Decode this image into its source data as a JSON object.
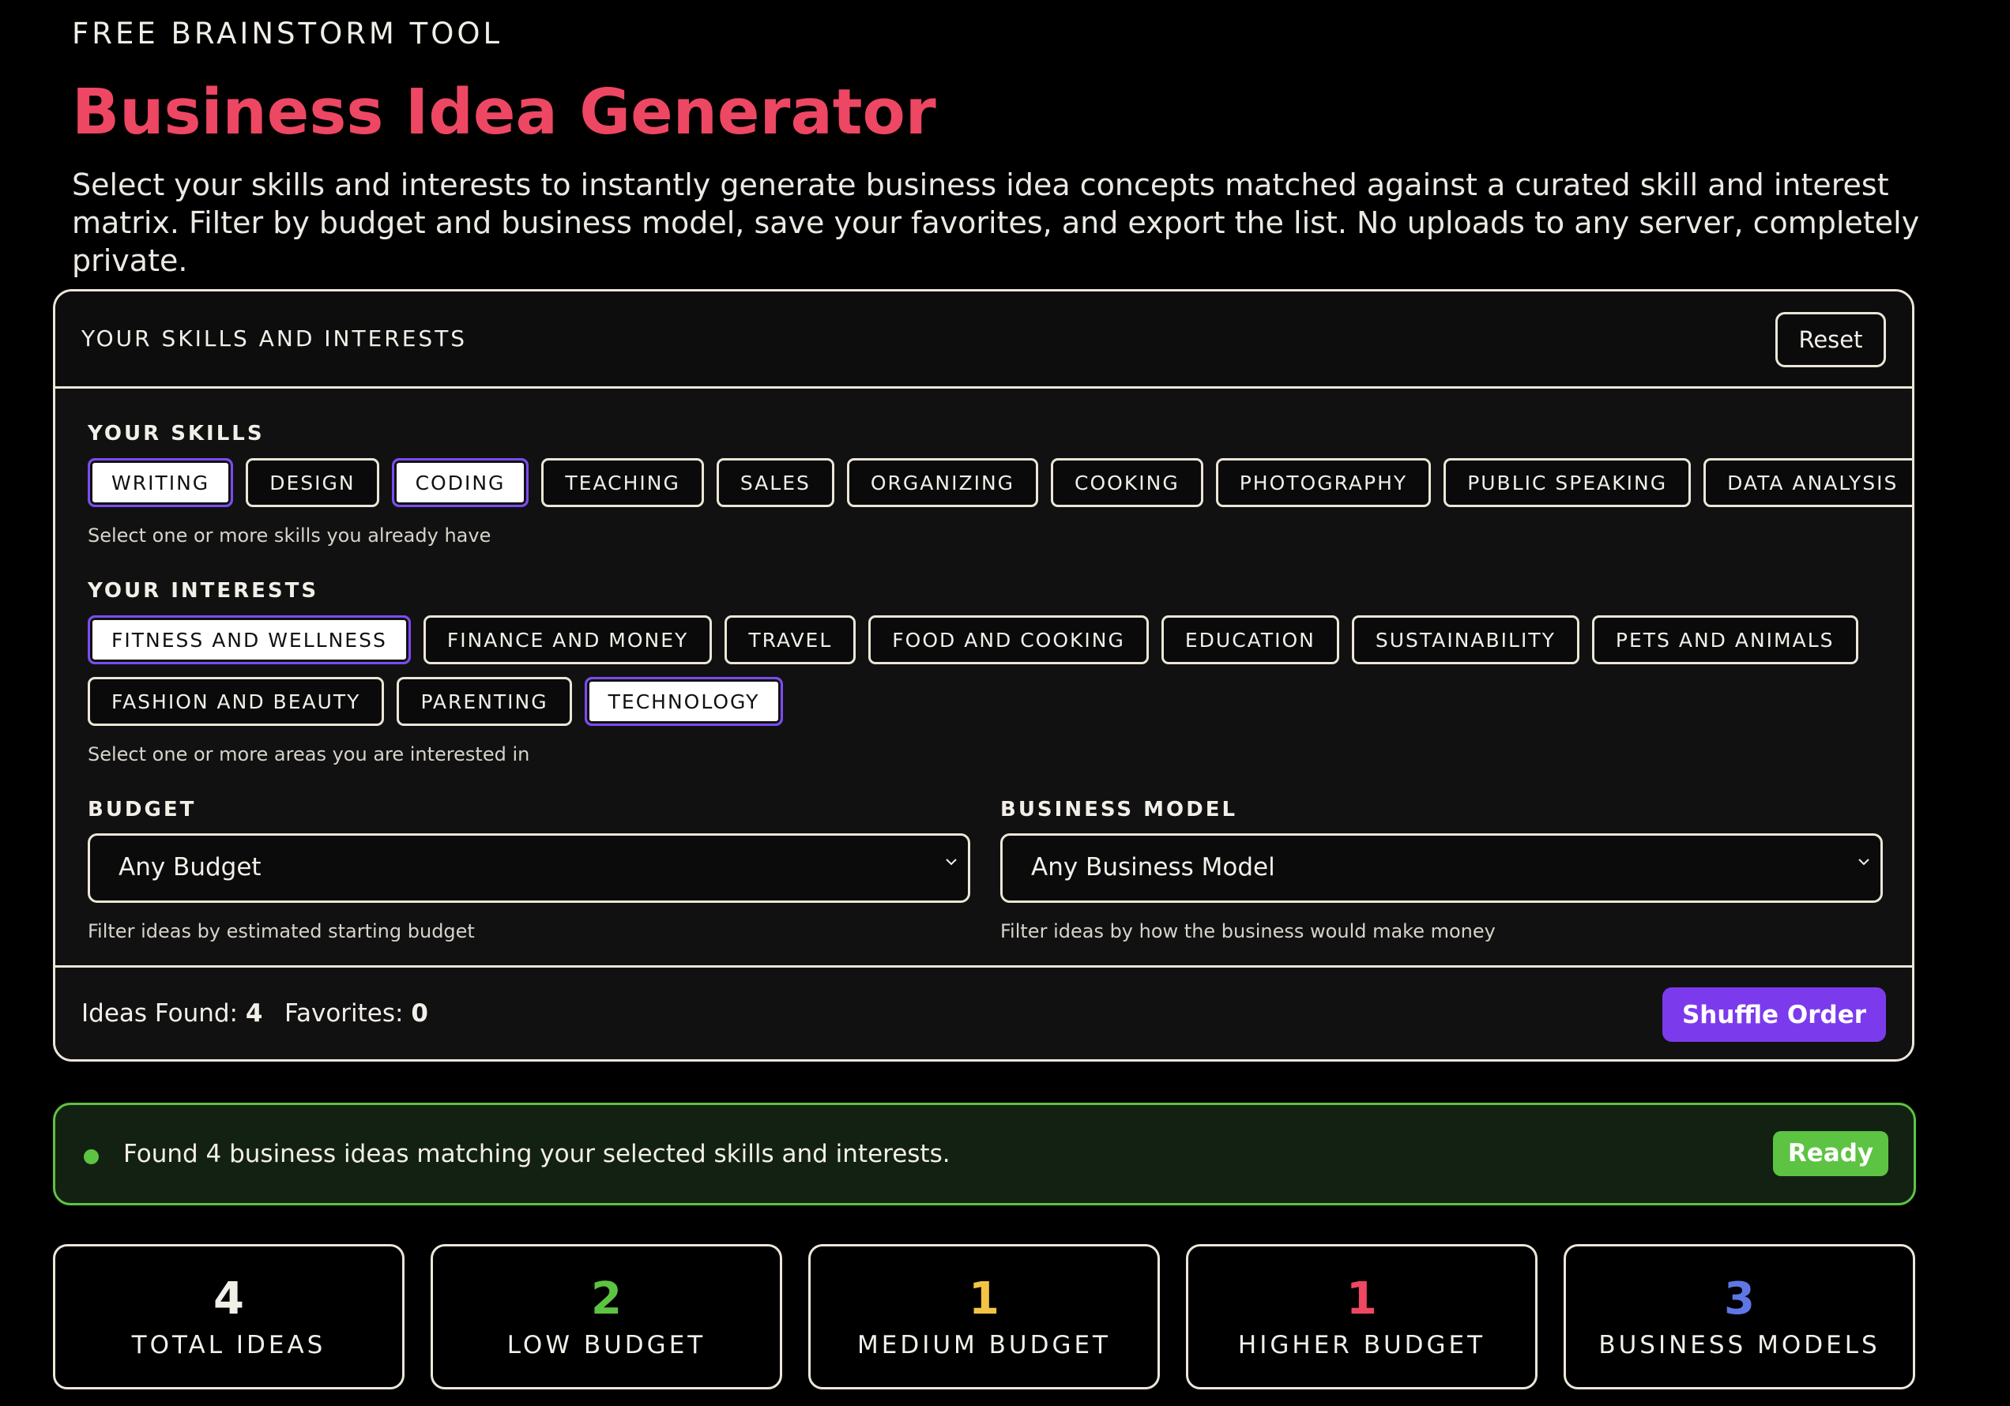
{
  "header": {
    "eyebrow": "FREE BRAINSTORM TOOL",
    "title": "Business Idea Generator",
    "description": "Select your skills and interests to instantly generate business idea concepts matched against a curated skill and interest matrix. Filter by budget and business model, save your favorites, and export the list. No uploads to any server, completely private."
  },
  "panel": {
    "title": "YOUR SKILLS AND INTERESTS",
    "reset_label": "Reset",
    "skills": {
      "label": "YOUR SKILLS",
      "helper": "Select one or more skills you already have",
      "items": [
        {
          "label": "WRITING",
          "selected": true
        },
        {
          "label": "DESIGN",
          "selected": false
        },
        {
          "label": "CODING",
          "selected": true
        },
        {
          "label": "TEACHING",
          "selected": false
        },
        {
          "label": "SALES",
          "selected": false
        },
        {
          "label": "ORGANIZING",
          "selected": false
        },
        {
          "label": "COOKING",
          "selected": false
        },
        {
          "label": "PHOTOGRAPHY",
          "selected": false
        },
        {
          "label": "PUBLIC SPEAKING",
          "selected": false
        },
        {
          "label": "DATA ANALYSIS",
          "selected": false
        }
      ]
    },
    "interests": {
      "label": "YOUR INTERESTS",
      "helper": "Select one or more areas you are interested in",
      "items": [
        {
          "label": "FITNESS AND WELLNESS",
          "selected": true
        },
        {
          "label": "FINANCE AND MONEY",
          "selected": false
        },
        {
          "label": "TRAVEL",
          "selected": false
        },
        {
          "label": "FOOD AND COOKING",
          "selected": false
        },
        {
          "label": "EDUCATION",
          "selected": false
        },
        {
          "label": "SUSTAINABILITY",
          "selected": false
        },
        {
          "label": "PETS AND ANIMALS",
          "selected": false
        },
        {
          "label": "FASHION AND BEAUTY",
          "selected": false
        },
        {
          "label": "PARENTING",
          "selected": false
        },
        {
          "label": "TECHNOLOGY",
          "selected": true
        }
      ]
    },
    "budget": {
      "label": "BUDGET",
      "value": "Any Budget",
      "helper": "Filter ideas by estimated starting budget"
    },
    "business_model": {
      "label": "BUSINESS MODEL",
      "value": "Any Business Model",
      "helper": "Filter ideas by how the business would make money"
    },
    "footer": {
      "ideas_found_label": "Ideas Found:",
      "ideas_found_value": "4",
      "favorites_label": "Favorites:",
      "favorites_value": "0",
      "shuffle_label": "Shuffle Order"
    }
  },
  "status": {
    "message": "Found 4 business ideas matching your selected skills and interests.",
    "badge": "Ready"
  },
  "stats": [
    {
      "value": "4",
      "label": "TOTAL IDEAS",
      "color": "#f2efe9"
    },
    {
      "value": "2",
      "label": "LOW BUDGET",
      "color": "#5dc342"
    },
    {
      "value": "1",
      "label": "MEDIUM BUDGET",
      "color": "#f3c443"
    },
    {
      "value": "1",
      "label": "HIGHER BUDGET",
      "color": "#ee4763"
    },
    {
      "value": "3",
      "label": "BUSINESS MODELS",
      "color": "#5f77e6"
    }
  ],
  "colors": {
    "accent_purple": "#7c3aed",
    "title_red": "#ee4763",
    "success_green": "#5dc342"
  }
}
